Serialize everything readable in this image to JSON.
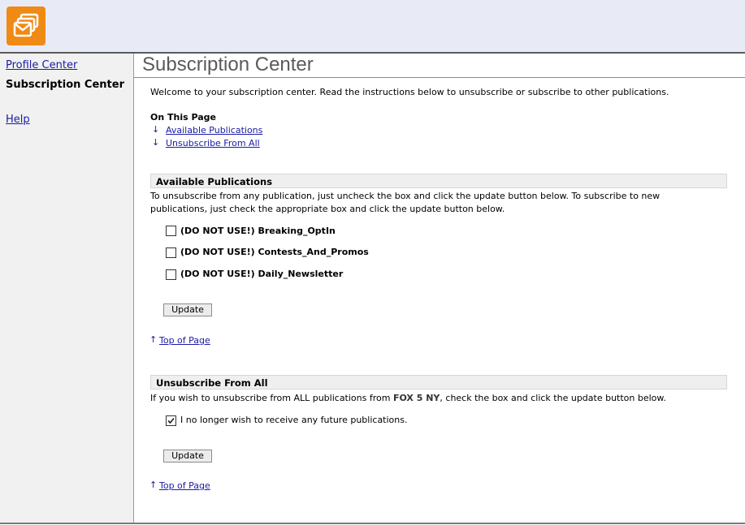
{
  "logo": {
    "icon": "envelope-stack-icon",
    "color": "#ef8a14"
  },
  "sidebar": {
    "profile_center": "Profile Center",
    "subscription_center": "Subscription Center",
    "help": "Help"
  },
  "main": {
    "title": "Subscription Center",
    "welcome": "Welcome to your subscription center. Read the instructions below to unsubscribe or subscribe to other publications.",
    "on_this_page": "On This Page",
    "toc": [
      "Available Publications",
      "Unsubscribe From All"
    ]
  },
  "available": {
    "heading": "Available Publications",
    "instructions_line1": "To unsubscribe from any publication, just uncheck the box and click the update button below. To subscribe to new",
    "instructions_line2": "publications, just check the appropriate box and click the update button below.",
    "publications": [
      {
        "label": "(DO NOT USE!) Breaking_OptIn",
        "checked": false
      },
      {
        "label": "(DO NOT USE!) Contests_And_Promos",
        "checked": false
      },
      {
        "label": "(DO NOT USE!) Daily_Newsletter",
        "checked": false
      }
    ],
    "update_label": "Update",
    "top_of_page": "Top of Page"
  },
  "unsubscribe": {
    "heading": "Unsubscribe From All",
    "instructions_pre": "If you wish to unsubscribe from ALL publications from ",
    "brand": "FOX 5 NY",
    "instructions_post": ", check the box and click the update button below.",
    "checkbox_label": "I no longer wish to receive any future publications.",
    "checked": true,
    "update_label": "Update",
    "top_of_page": "Top of Page"
  }
}
